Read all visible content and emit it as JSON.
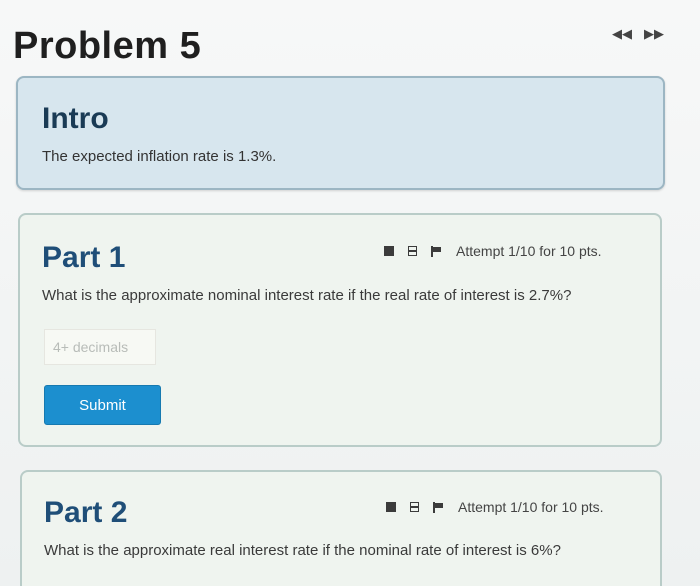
{
  "page": {
    "title": "Problem 5",
    "nav": {
      "prev": "◀◀",
      "next": "▶▶"
    }
  },
  "intro": {
    "heading": "Intro",
    "text": "The expected inflation rate is 1.3%."
  },
  "parts": [
    {
      "heading": "Part 1",
      "attempt": "Attempt 1/10 for 10 pts.",
      "question": "What is the approximate nominal interest rate if the real rate of interest is 2.7%?",
      "input_placeholder": "4+ decimals",
      "submit_label": "Submit",
      "icons": [
        "notes-icon",
        "calculator-icon",
        "flag-icon"
      ]
    },
    {
      "heading": "Part 2",
      "attempt": "Attempt 1/10 for 10 pts.",
      "question": "What is the approximate real interest rate if the nominal rate of interest is 6%?",
      "icons": [
        "notes-icon",
        "calculator-icon",
        "flag-icon"
      ]
    }
  ]
}
